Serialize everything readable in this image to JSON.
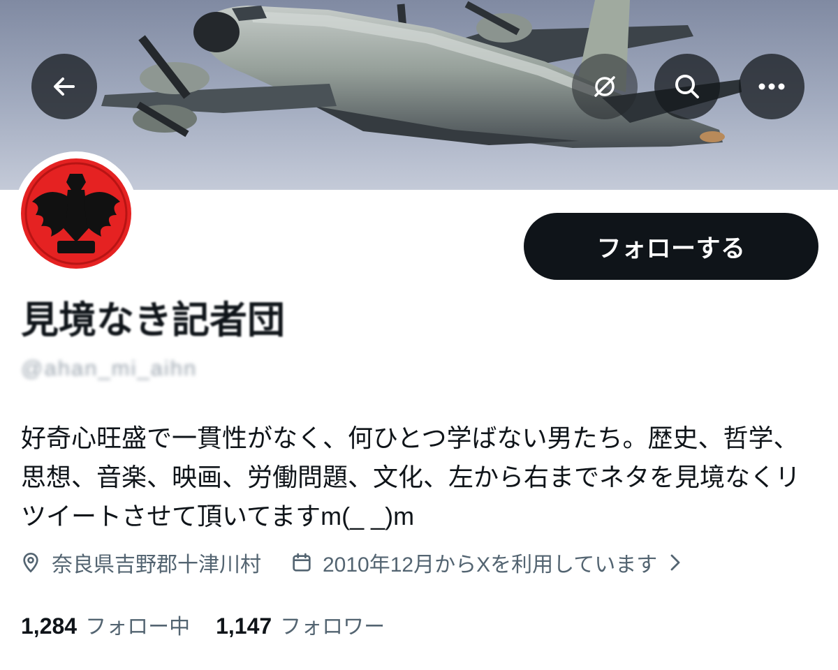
{
  "header": {
    "icons": {
      "back": "arrow-left-icon",
      "grok": "grok-icon",
      "search": "search-icon",
      "more": "more-horizontal-icon"
    }
  },
  "profile": {
    "display_name": "見境なき記者団",
    "handle": "@ahan_mi_aihn",
    "bio": "好奇心旺盛で一貫性がなく、何ひとつ学ばない男たち。歴史、哲学、思想、音楽、映画、労働問題、文化、左から右までネタを見境なくリツイートさせて頂いてますm(_ _)m",
    "location": "奈良県吉野郡十津川村",
    "location_icon": "map-pin-icon",
    "joined": "2010年12月からXを利用しています",
    "joined_icon": "calendar-icon",
    "joined_chevron_icon": "chevron-right-icon",
    "stats": {
      "following_count": "1,284",
      "following_label": "フォロー中",
      "followers_count": "1,147",
      "followers_label": "フォロワー"
    }
  },
  "actions": {
    "follow_label": "フォローする"
  },
  "colors": {
    "text_primary": "#0f1419",
    "text_secondary": "#536471",
    "follow_button_bg": "#0f1419",
    "follow_button_text": "#ffffff",
    "overlay_button_bg": "#14181c",
    "avatar_red": "#e52222"
  }
}
